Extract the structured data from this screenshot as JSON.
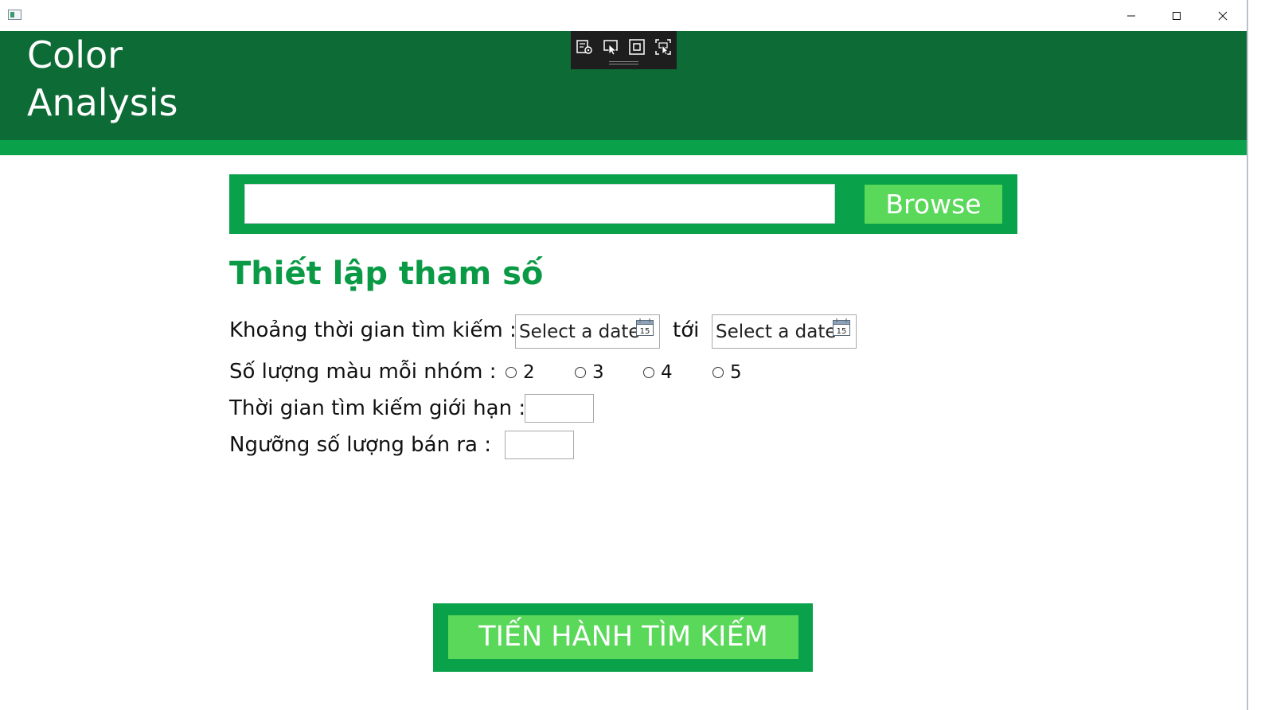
{
  "window": {
    "minimize_icon": "minimize-icon",
    "maximize_icon": "maximize-icon",
    "close_icon": "close-icon"
  },
  "header": {
    "title": "Color\nAnalysis",
    "background_color": "#0d6b36",
    "stripe_color": "#0aa14b"
  },
  "debug_toolbar": {
    "icons": [
      "live-visual-tree-icon",
      "select-element-icon",
      "display-layout-adorners-icon",
      "track-focused-element-icon"
    ]
  },
  "browse": {
    "path_value": "",
    "button_label": "Browse"
  },
  "params": {
    "section_title": "Thiết lập tham số",
    "date_range_label": "Khoảng thời gian tìm kiếm :",
    "date_from_placeholder": "Select a date",
    "date_to_label": "tới",
    "date_to_placeholder": "Select a date",
    "calendar_icon_text": "15",
    "colors_per_group_label": "Số lượng màu mỗi nhóm :",
    "colors_options": [
      "2",
      "3",
      "4",
      "5"
    ],
    "search_time_limit_label": "Thời gian tìm kiếm giới hạn :",
    "search_time_limit_value": "",
    "sales_threshold_label": "Ngưỡng số lượng bán ra :",
    "sales_threshold_value": ""
  },
  "actions": {
    "search_button_label": "TIẾN HÀNH TÌM KIẾM",
    "accent_color": "#5ad85a"
  }
}
